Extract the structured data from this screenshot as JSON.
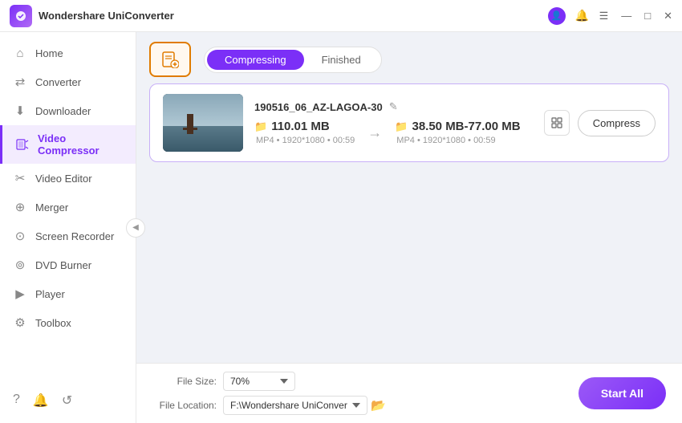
{
  "app": {
    "title": "Wondershare UniConverter",
    "logo_alt": "uniconverter-logo"
  },
  "titlebar": {
    "user_icon": "👤",
    "bell_icon": "🔔",
    "menu_icon": "☰",
    "min_icon": "—",
    "max_icon": "□",
    "close_icon": "✕"
  },
  "sidebar": {
    "items": [
      {
        "id": "home",
        "label": "Home",
        "icon": "⌂"
      },
      {
        "id": "converter",
        "label": "Converter",
        "icon": "↔"
      },
      {
        "id": "downloader",
        "label": "Downloader",
        "icon": "↓"
      },
      {
        "id": "video-compressor",
        "label": "Video Compressor",
        "icon": "▣",
        "active": true
      },
      {
        "id": "video-editor",
        "label": "Video Editor",
        "icon": "✂"
      },
      {
        "id": "merger",
        "label": "Merger",
        "icon": "⊕"
      },
      {
        "id": "screen-recorder",
        "label": "Screen Recorder",
        "icon": "⊙"
      },
      {
        "id": "dvd-burner",
        "label": "DVD Burner",
        "icon": "⊚"
      },
      {
        "id": "player",
        "label": "Player",
        "icon": "▶"
      },
      {
        "id": "toolbox",
        "label": "Toolbox",
        "icon": "⚙"
      }
    ],
    "bottom_icons": [
      "?",
      "🔔",
      "↺"
    ]
  },
  "toolbar": {
    "add_file_plus": "+",
    "tabs": [
      {
        "id": "compressing",
        "label": "Compressing",
        "active": true
      },
      {
        "id": "finished",
        "label": "Finished",
        "active": false
      }
    ]
  },
  "files": [
    {
      "id": "file-1",
      "name": "190516_06_AZ-LAGOA-30",
      "source_size": "110.01 MB",
      "source_meta": "MP4  •  1920*1080  •  00:59",
      "target_size": "38.50 MB-77.00 MB",
      "target_meta": "MP4  •  1920*1080  •  00:59",
      "compress_btn": "Compress"
    }
  ],
  "footer": {
    "file_size_label": "File Size:",
    "file_size_value": "70%",
    "file_location_label": "File Location:",
    "file_location_value": "F:\\Wondershare UniConverte",
    "start_all_label": "Start All"
  }
}
